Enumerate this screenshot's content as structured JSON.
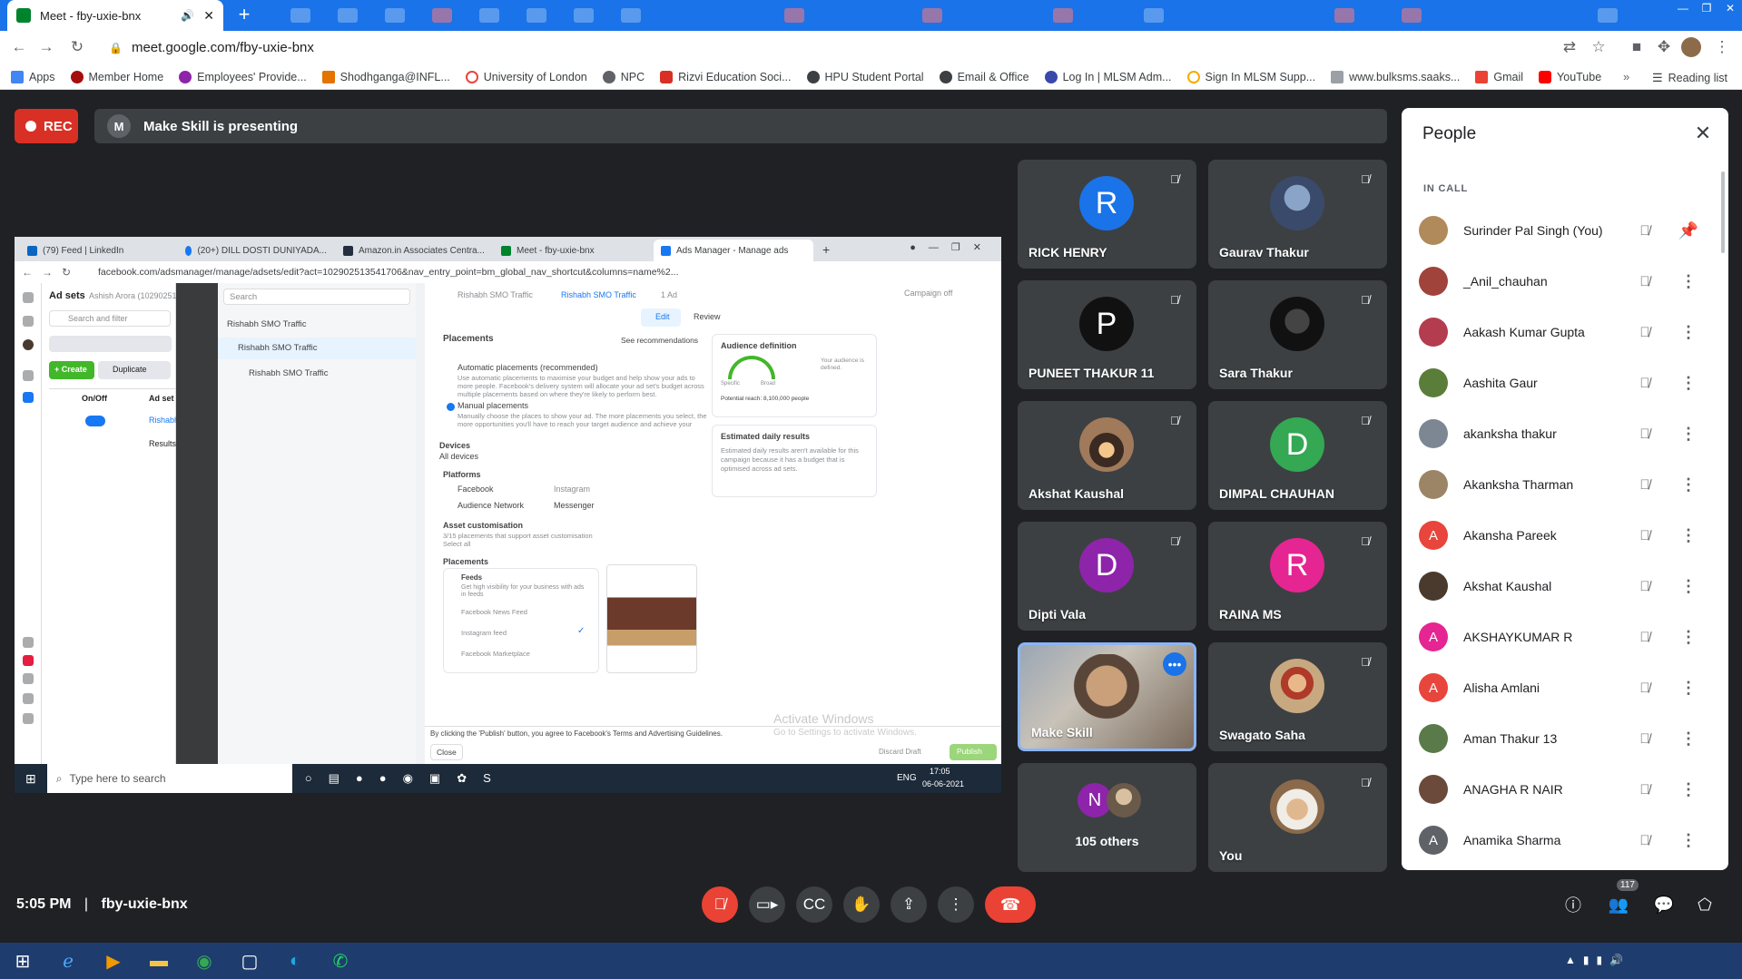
{
  "browser": {
    "tab_title": "Meet - fby-uxie-bnx",
    "url": "meet.google.com/fby-uxie-bnx",
    "bookmarks": [
      "Apps",
      "Member Home",
      "Employees' Provide...",
      "Shodhganga@INFL...",
      "University of London",
      "NPC",
      "Rizvi Education Soci...",
      "HPU Student Portal",
      "Email & Office",
      "Log In | MLSM Adm...",
      "Sign In MLSM Supp...",
      "www.bulksms.saaks...",
      "Gmail",
      "YouTube"
    ],
    "reading_list": "Reading list"
  },
  "meet": {
    "rec_label": "REC",
    "presenter_initial": "M",
    "presenting_text": "Make Skill is presenting",
    "time": "5:05 PM",
    "separator": "|",
    "meeting_code": "fby-uxie-bnx",
    "people_count": "117"
  },
  "shared": {
    "tabs": [
      "(79) Feed | LinkedIn",
      "(20+) DILL DOSTI DUNIYADA...",
      "Amazon.in Associates Centra...",
      "Meet - fby-uxie-bnx",
      "Ads Manager - Manage ads"
    ],
    "url": "facebook.com/adsmanager/manage/adsets/edit?act=102902513541706&nav_entry_point=bm_global_nav_shortcut&columns=name%2...",
    "adsets_title": "Ad sets",
    "account": "Ashish Arora (10290251...",
    "search_filter": "Search and filter",
    "create": "+ Create",
    "duplicate": "Duplicate",
    "col_onoff": "On/Off",
    "col_name": "Ad set name",
    "row_name": "Rishabh SMO Tr...",
    "results_from": "Results from",
    "tree_search": "Search",
    "tree": [
      "Rishabh SMO Traffic",
      "Rishabh SMO Traffic",
      "Rishabh SMO Traffic"
    ],
    "breadcrumb": [
      "Rishabh SMO Traffic",
      "Rishabh SMO Traffic",
      "1 Ad"
    ],
    "campaign_off": "Campaign off",
    "edit": "Edit",
    "review": "Review",
    "placements": "Placements",
    "see_recs": "See recommendations",
    "auto_placements": "Automatic placements (recommended)",
    "auto_desc": "Use automatic placements to maximise your budget and help show your ads to more people. Facebook's delivery system will allocate your ad set's budget across multiple placements based on where they're likely to perform best.",
    "manual_placements": "Manual placements",
    "manual_desc": "Manually choose the places to show your ad. The more placements you select, the more opportunities you'll have to reach your target audience and achieve your business goals.",
    "devices": "Devices",
    "all_devices": "All devices",
    "platforms": "Platforms",
    "platform_items": [
      "Facebook",
      "Instagram",
      "Audience Network",
      "Messenger"
    ],
    "asset_custom": "Asset customisation",
    "asset_desc": "3/15 placements that support asset customisation",
    "select_all": "Select all",
    "placements2": "Placements",
    "feeds": "Feeds",
    "feeds_desc": "Get high visibility for your business with ads in feeds",
    "feed_items": [
      "Facebook News Feed",
      "Instagram feed",
      "Facebook Marketplace"
    ],
    "audience_def": "Audience definition",
    "audience_note": "Your audience is defined.",
    "specific": "Specific",
    "broad": "Broad",
    "potential_reach": "Potential reach: 8,100,000 people",
    "est_daily": "Estimated daily results",
    "est_desc": "Estimated daily results aren't available for this campaign because it has a budget that is optimised across ad sets.",
    "footer_text": "By clicking the 'Publish' button, you agree to Facebook's Terms and Advertising Guidelines.",
    "close": "Close",
    "discard": "Discard Draft",
    "publish": "Publish",
    "activate_title": "Activate Windows",
    "activate_sub": "Go to Settings to activate Windows.",
    "task_search": "Type here to search",
    "lang": "ENG",
    "task_time": "17:05",
    "task_date": "06-06-2021"
  },
  "tiles": [
    {
      "name": "RICK HENRY",
      "initial": "R",
      "color": "#1a73e8"
    },
    {
      "name": "Gaurav Thakur",
      "initial": "",
      "color": ""
    },
    {
      "name": "PUNEET THAKUR 11",
      "initial": "P",
      "color": "#111111"
    },
    {
      "name": "Sara Thakur",
      "initial": "",
      "color": ""
    },
    {
      "name": "Akshat Kaushal",
      "initial": "",
      "color": ""
    },
    {
      "name": "DIMPAL CHAUHAN",
      "initial": "D",
      "color": "#34a853"
    },
    {
      "name": "Dipti Vala",
      "initial": "D",
      "color": "#8e24aa"
    },
    {
      "name": "RAINA MS",
      "initial": "R",
      "color": "#e52592"
    },
    {
      "name": "Make Skill",
      "initial": "",
      "color": ""
    },
    {
      "name": "Swagato Saha",
      "initial": "",
      "color": ""
    },
    {
      "name": "105 others",
      "initial": "N",
      "color": "#8e24aa"
    },
    {
      "name": "You",
      "initial": "",
      "color": ""
    }
  ],
  "people": {
    "title": "People",
    "section": "IN CALL",
    "list": [
      {
        "name": "Surinder Pal Singh (You)",
        "initial": "",
        "color": "#b08a5a"
      },
      {
        "name": "_Anil_chauhan",
        "initial": "",
        "color": "#a0433a"
      },
      {
        "name": "Aakash Kumar Gupta",
        "initial": "",
        "color": "#b43c4f"
      },
      {
        "name": "Aashita Gaur",
        "initial": "",
        "color": "#5b7d3a"
      },
      {
        "name": "akanksha thakur",
        "initial": "",
        "color": "#7d8794"
      },
      {
        "name": "Akanksha Tharman",
        "initial": "",
        "color": "#9c8566"
      },
      {
        "name": "Akansha Pareek",
        "initial": "A",
        "color": "#e8453c"
      },
      {
        "name": "Akshat Kaushal",
        "initial": "",
        "color": "#4a3a2e"
      },
      {
        "name": "AKSHAYKUMAR R",
        "initial": "A",
        "color": "#e52592"
      },
      {
        "name": "Alisha Amlani",
        "initial": "A",
        "color": "#e8453c"
      },
      {
        "name": "Aman Thakur 13",
        "initial": "",
        "color": "#5a7a4a"
      },
      {
        "name": "ANAGHA R NAIR",
        "initial": "",
        "color": "#6b4a3c"
      },
      {
        "name": "Anamika Sharma",
        "initial": "A",
        "color": "#5f6368"
      }
    ]
  }
}
